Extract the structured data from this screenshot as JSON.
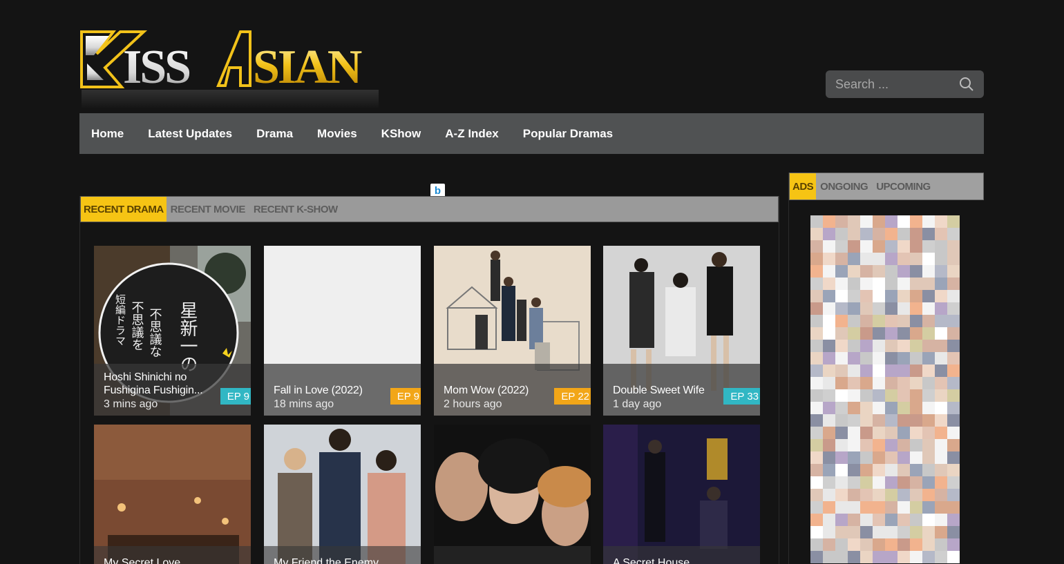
{
  "brand": {
    "logo_text": "KISSASIAN"
  },
  "search": {
    "placeholder": "Search ..."
  },
  "nav": {
    "items": [
      "Home",
      "Latest Updates",
      "Drama",
      "Movies",
      "KShow",
      "A-Z Index",
      "Popular Dramas"
    ]
  },
  "main": {
    "tabs": [
      "RECENT DRAMA",
      "RECENT MOVIE",
      "RECENT K-SHOW"
    ],
    "active_tab": "RECENT DRAMA",
    "adchoices_icon": "b",
    "cards": [
      {
        "title": "Hoshi Shinichi no Fushigina Fushigin...",
        "time": "3 mins ago",
        "episode": "EP 9",
        "badge_color": "#31b7c4",
        "poster_text": "不思議を 不思議な 短編ドラマ 星新一の"
      },
      {
        "title": "Fall in Love (2022)",
        "time": "18 mins ago",
        "episode": "EP 9",
        "badge_color": "#f2a618"
      },
      {
        "title": "Mom Wow (2022)",
        "time": "2 hours ago",
        "episode": "EP 22",
        "badge_color": "#f2a618"
      },
      {
        "title": "Double Sweet Wife",
        "time": "1 day ago",
        "episode": "EP 33",
        "badge_color": "#31b7c4"
      }
    ],
    "cards_row2": [
      {
        "title": "My Secret Love"
      },
      {
        "title": "My Friend the Enemy"
      },
      {
        "title": ""
      },
      {
        "title": "A Secret House"
      }
    ]
  },
  "sidebar": {
    "tabs": [
      "ADS",
      "ONGOING",
      "UPCOMING"
    ],
    "active_tab": "ADS"
  },
  "colors": {
    "accent": "#f6c414",
    "nav_bg": "#505253",
    "background": "#141414",
    "badge_teal": "#31b7c4",
    "badge_gold": "#f2a618"
  },
  "icons": {
    "search": "search-icon",
    "adchoices": "adchoices-icon"
  }
}
